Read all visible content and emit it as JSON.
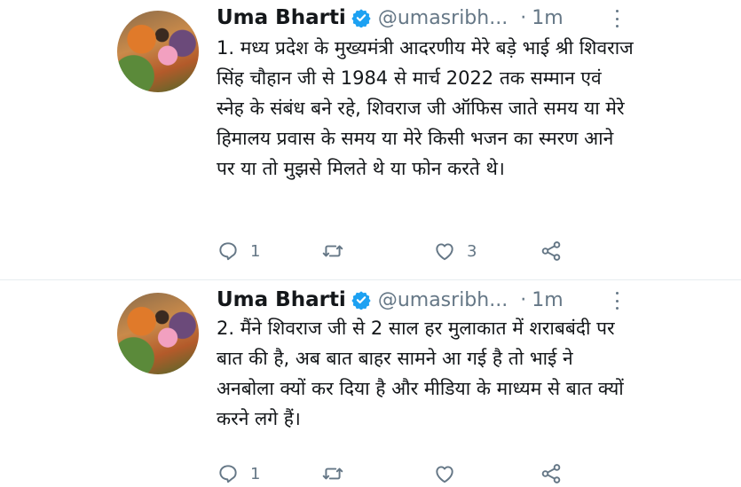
{
  "tweets": [
    {
      "author_name": "Uma Bharti",
      "handle": "@umasribh...",
      "separator": "·",
      "time": "1m",
      "text": "1. मध्य प्रदेश के मुख्यमंत्री आदरणीय मेरे बड़े भाई श्री शिवराज सिंह चौहान जी से 1984 से मार्च 2022 तक सम्मान एवं स्नेह के संबंध बने रहे, शिवराज जी ऑफिस जाते समय या मेरे हिमालय प्रवास के समय या मेरे किसी भजन का स्मरण आने पर या तो मुझसे मिलते थे या फोन करते थे।",
      "reply_count": "1",
      "retweet_count": "",
      "like_count": "3"
    },
    {
      "author_name": "Uma Bharti",
      "handle": "@umasribh...",
      "separator": "·",
      "time": "1m",
      "text": "2. मैंने शिवराज जी से 2 साल हर मुलाकात में शराबबंदी पर बात की है, अब बात बाहर सामने आ गई है तो भाई ने अनबोला क्यों कर दिया है और मीडिया के माध्यम से बात क्यों करने लगे हैं।",
      "reply_count": "1",
      "retweet_count": "",
      "like_count": ""
    }
  ],
  "icons": {
    "verified": "verified-badge-icon",
    "more": "more-vertical-icon",
    "reply": "reply-bubble-icon",
    "retweet": "retweet-arrows-icon",
    "like": "heart-outline-icon",
    "share": "share-nodes-icon"
  },
  "colors": {
    "verified_blue": "#1da1f2",
    "secondary_text": "#657786",
    "primary_text": "#14171a"
  }
}
